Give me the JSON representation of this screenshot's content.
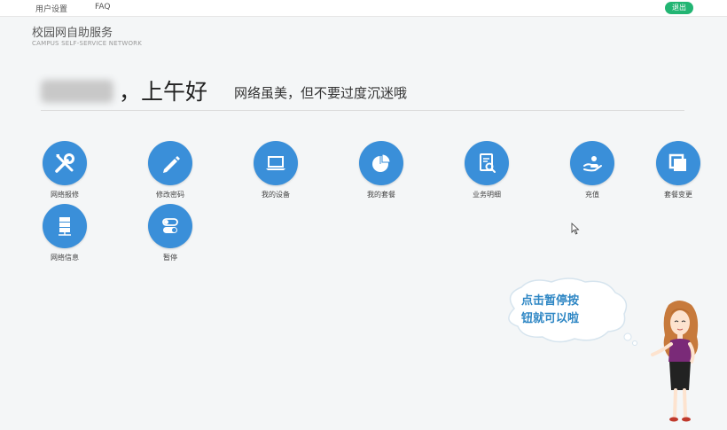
{
  "topbar": {
    "user_settings": "用户设置",
    "faq": "FAQ",
    "logout": "退出"
  },
  "brand": {
    "title": "校园网自助服务",
    "subtitle": "CAMPUS SELF-SERVICE NETWORK"
  },
  "greeting": {
    "text": "，上午好",
    "slogan": "网络虽美，但不要过度沉迷哦"
  },
  "tiles": [
    {
      "label": "网络报修",
      "icon": "wrench-screwdriver-icon"
    },
    {
      "label": "修改密码",
      "icon": "pencil-icon"
    },
    {
      "label": "我的设备",
      "icon": "laptop-icon"
    },
    {
      "label": "我的套餐",
      "icon": "pie-chart-icon"
    },
    {
      "label": "业务明细",
      "icon": "document-search-icon"
    },
    {
      "label": "充值",
      "icon": "hand-coin-icon"
    },
    {
      "label": "套餐变更",
      "icon": "windows-stack-icon"
    },
    {
      "label": "网络信息",
      "icon": "server-icon"
    },
    {
      "label": "暂停",
      "icon": "toggle-switch-icon"
    }
  ],
  "tip": {
    "line1": "点击暂停按",
    "line2": "钮就可以啦"
  },
  "colors": {
    "accent": "#3a8fd9",
    "logout": "#22b573",
    "tip_text": "#2d86c4"
  }
}
